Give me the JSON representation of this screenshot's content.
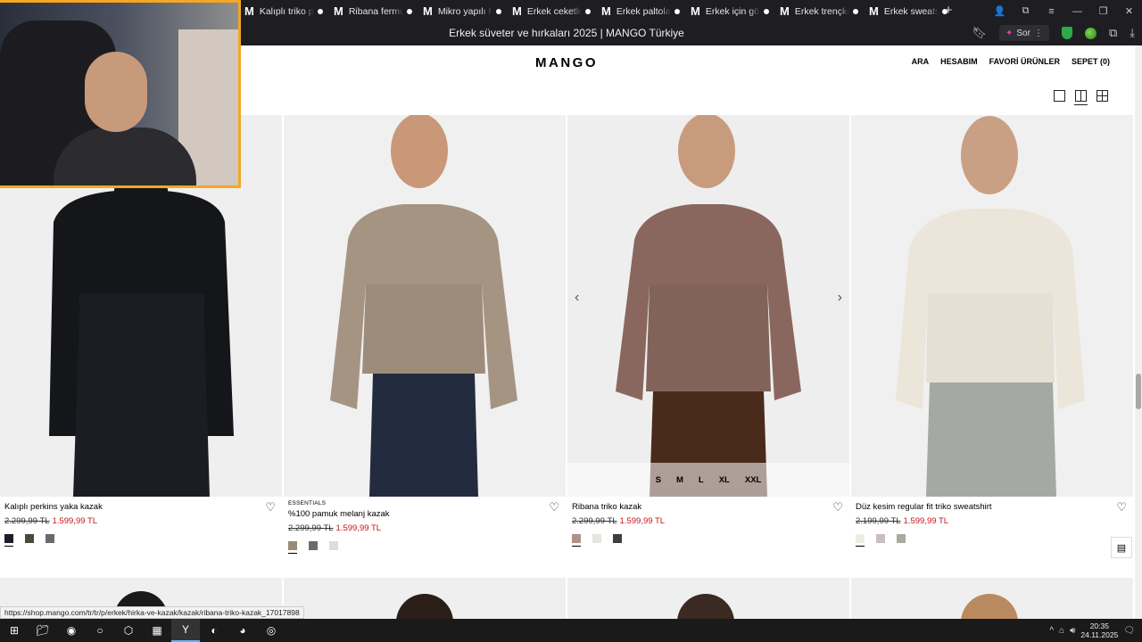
{
  "browser": {
    "tabs": [
      {
        "icon": "M",
        "title": "Kalıplı triko po"
      },
      {
        "icon": "M",
        "title": "Ribana fermua"
      },
      {
        "icon": "M",
        "title": "Mikro yapılı fer"
      },
      {
        "icon": "M",
        "title": "Erkek ceketleri"
      },
      {
        "icon": "M",
        "title": "Erkek paltoları"
      },
      {
        "icon": "M",
        "title": "Erkek için göm"
      },
      {
        "icon": "M",
        "title": "Erkek trençkot"
      },
      {
        "icon": "M",
        "title": "Erkek sweatshi"
      }
    ],
    "page_title": "Erkek süveter ve hırkaları 2025 | MANGO Türkiye",
    "sor_label": "Sor",
    "status_url": "https://shop.mango.com/tr/tr/p/erkek/hirka-ve-kazak/kazak/ribana-triko-kazak_17017898"
  },
  "site": {
    "logo": "MANGO",
    "nav": [
      "ARA",
      "HESABIM",
      "FAVORİ ÜRÜNLER",
      "SEPET (0)"
    ]
  },
  "products": [
    {
      "tag": "",
      "name": "Kalıplı perkins yaka kazak",
      "old_price": "2.299,99 TL",
      "new_price": "1.599,99 TL",
      "swatches": [
        "#1c1f2a",
        "#4a4a38",
        "#6a6a6a"
      ]
    },
    {
      "tag": "ESSENTIALS",
      "name": "%100 pamuk melanj kazak",
      "old_price": "2.299,99 TL",
      "new_price": "1.599,99 TL",
      "swatches": [
        "#9b8a78",
        "#6b6b6b",
        "#e0ddd6"
      ]
    },
    {
      "tag": "",
      "name": "Ribana triko kazak",
      "old_price": "2.299,99 TL",
      "new_price": "1.599,99 TL",
      "swatches": [
        "#b0928a",
        "#e6e4df",
        "#3f3f3f"
      ],
      "sizes": [
        "S",
        "M",
        "L",
        "XL",
        "XXL"
      ]
    },
    {
      "tag": "",
      "name": "Düz kesim regular fit triko sweatshirt",
      "old_price": "2.199,99 TL",
      "new_price": "1.599,99 TL",
      "swatches": [
        "#efece5",
        "#c9bfbd",
        "#a9a9a0"
      ]
    }
  ],
  "taskbar": {
    "time": "20:35",
    "date": "24.11.2025"
  }
}
